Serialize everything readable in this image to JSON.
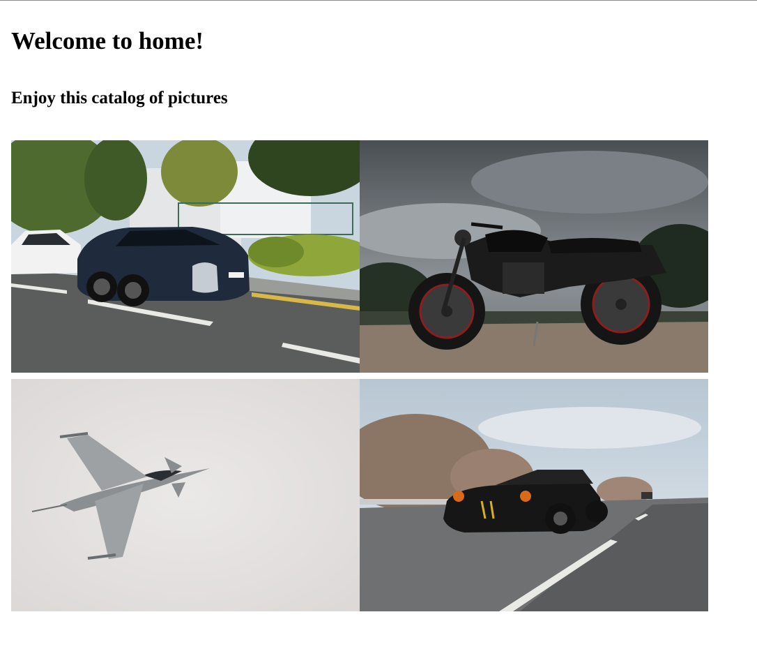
{
  "page": {
    "heading": "Welcome to home!",
    "subheading": "Enjoy this catalog of pictures"
  },
  "gallery": {
    "photos": [
      {
        "subject": "black sports car on street"
      },
      {
        "subject": "black motorcycle under cloudy sky"
      },
      {
        "subject": "fighter jet in grey sky"
      },
      {
        "subject": "black muscle car on highway"
      }
    ]
  },
  "colors": {
    "text": "#000000",
    "background": "#ffffff"
  }
}
